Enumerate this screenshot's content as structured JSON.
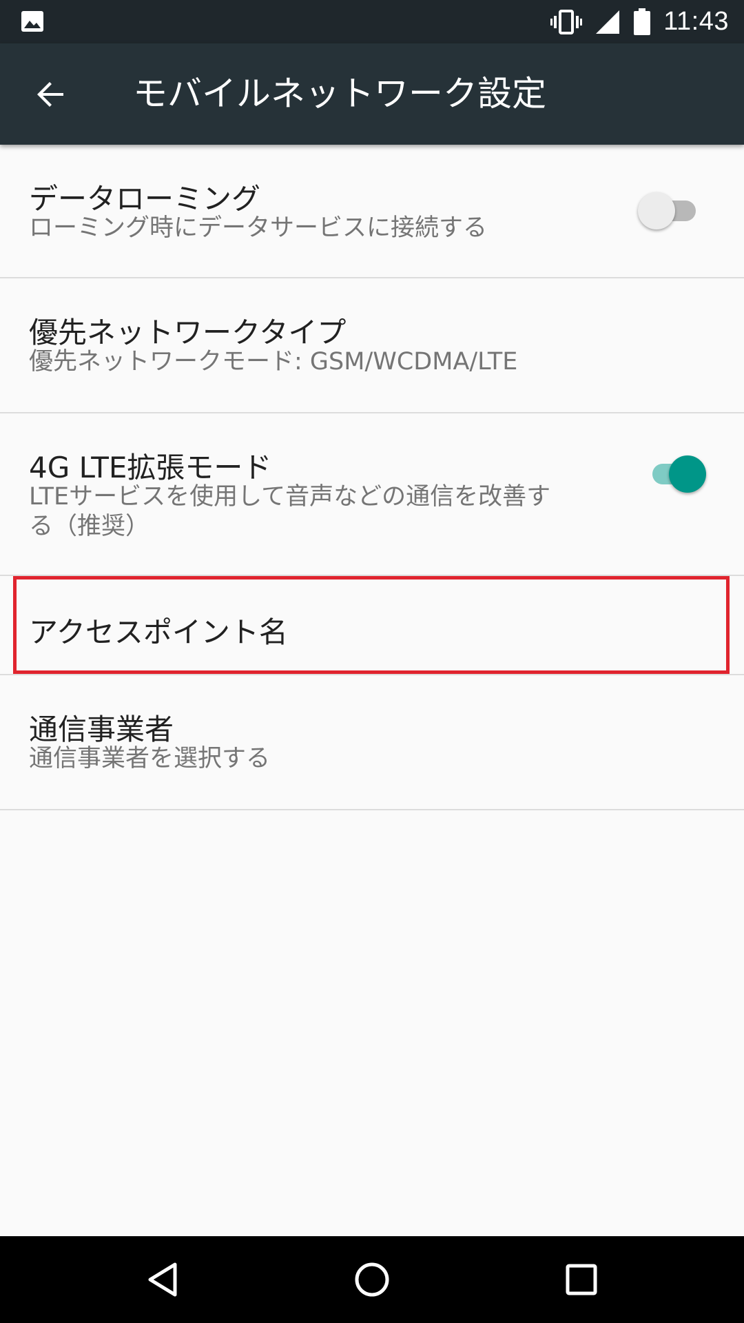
{
  "status_bar": {
    "time": "11:43",
    "icons": [
      "image-notification-icon",
      "vibrate-icon",
      "signal-icon",
      "battery-icon"
    ]
  },
  "toolbar": {
    "title": "モバイルネットワーク設定",
    "back_icon": "arrow-back-icon"
  },
  "preferences": [
    {
      "title": "データローミング",
      "summary": "ローミング時にデータサービスに接続する",
      "switch": "off"
    },
    {
      "title": "優先ネットワークタイプ",
      "summary": "優先ネットワークモード: GSM/WCDMA/LTE"
    },
    {
      "title": "4G LTE拡張モード",
      "summary_line1": "LTEサービスを使用して音声などの通信を改善す",
      "summary_line2": "る（推奨）",
      "switch": "on"
    },
    {
      "title": "アクセスポイント名",
      "highlighted": true
    },
    {
      "title": "通信事業者",
      "summary": "通信事業者を選択する"
    }
  ],
  "nav_bar": {
    "icons": [
      "back-triangle-icon",
      "home-circle-icon",
      "recents-square-icon"
    ]
  },
  "colors": {
    "status_bar": "#1f272c",
    "toolbar": "#263238",
    "accent": "#009688",
    "highlight": "#e0242e",
    "background": "#fafafa"
  }
}
